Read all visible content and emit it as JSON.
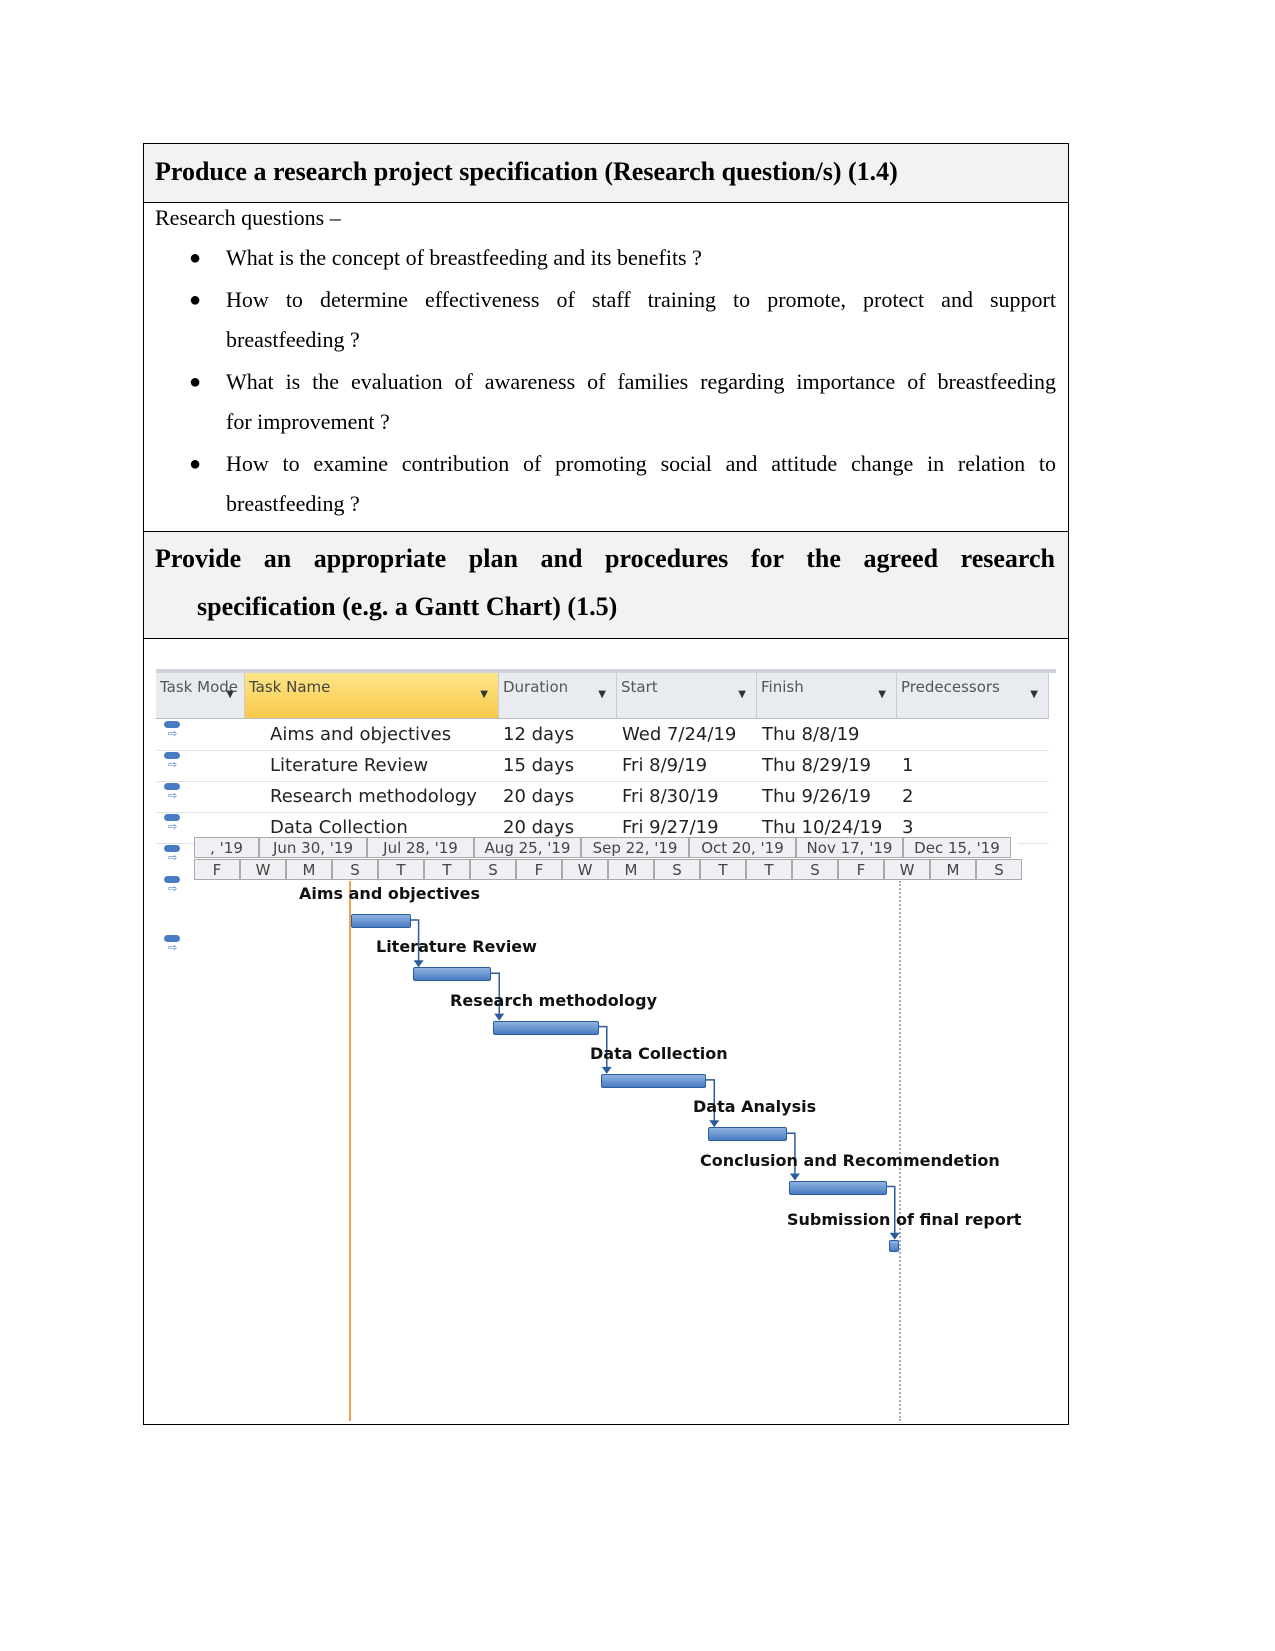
{
  "section1": {
    "heading": "Produce a research project specification (Research question/s)  (1.4)",
    "intro": "Research questions –",
    "questions": [
      "What is the concept of breastfeeding and its benefits ?",
      "How to determine effectiveness of staff training to promote, protect and support",
      "breastfeeding ?",
      "What is the evaluation of awareness of families regarding importance of breastfeeding",
      "for improvement ?",
      "How to examine contribution of promoting social and attitude change in relation to",
      "breastfeeding ?"
    ]
  },
  "section2": {
    "heading_line1": "Provide an appropriate plan and procedures for the agreed research",
    "heading_line2": "specification (e.g. a Gantt Chart) (1.5)"
  },
  "gantt": {
    "columns": [
      "Task Mode",
      "Task Name",
      "Duration",
      "Start",
      "Finish",
      "Predecessors"
    ],
    "rows": [
      {
        "name": "Aims and objectives",
        "duration": "12 days",
        "start": "Wed 7/24/19",
        "finish": "Thu 8/8/19",
        "pred": ""
      },
      {
        "name": "Literature Review",
        "duration": "15 days",
        "start": "Fri 8/9/19",
        "finish": "Thu 8/29/19",
        "pred": "1"
      },
      {
        "name": "Research methodology",
        "duration": "20 days",
        "start": "Fri 8/30/19",
        "finish": "Thu 9/26/19",
        "pred": "2"
      },
      {
        "name": "Data Collection",
        "duration": "20 days",
        "start": "Fri 9/27/19",
        "finish": "Thu 10/24/19",
        "pred": "3"
      }
    ],
    "timescale_top": [
      ", '19",
      "Jun 30, '19",
      "Jul 28, '19",
      "Aug 25, '19",
      "Sep 22, '19",
      "Oct 20, '19",
      "Nov 17, '19",
      "Dec 15, '19"
    ],
    "timescale_bottom": [
      "F",
      "W",
      "M",
      "S",
      "T",
      "T",
      "S",
      "F",
      "W",
      "M",
      "S",
      "T",
      "T",
      "S",
      "F",
      "W",
      "M",
      "S"
    ],
    "bar_labels": [
      "Aims and objectives",
      "Literature Review",
      "Research methodology",
      "Data Collection",
      "Data Analysis",
      "Conclusion and Recommendetion",
      "Submission of final report"
    ],
    "bar_color": "#4a7cc3",
    "today_line_color": "#f0a050"
  }
}
